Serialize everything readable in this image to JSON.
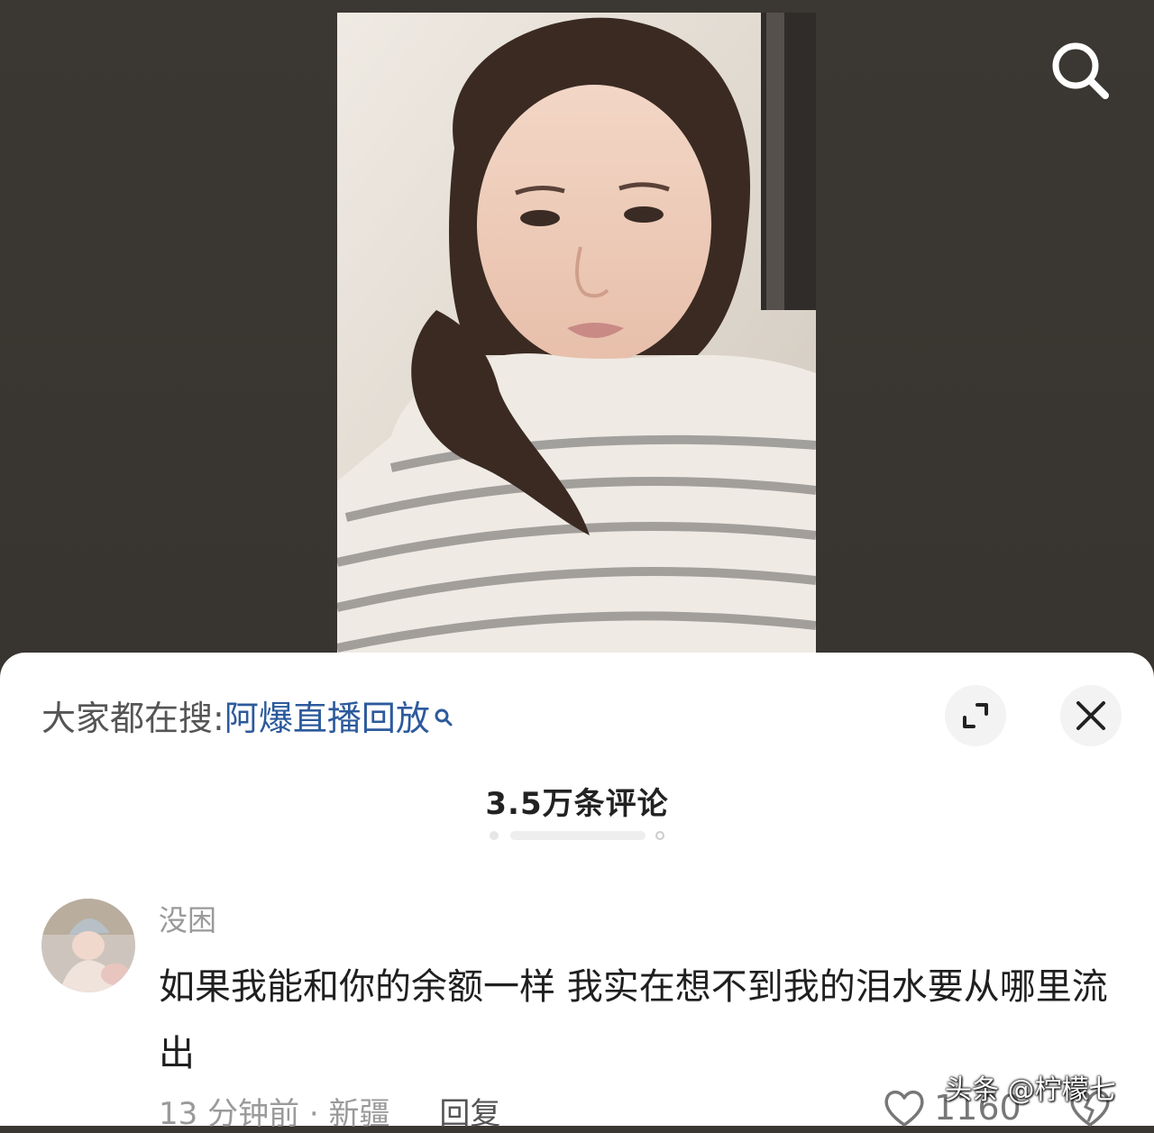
{
  "video": {
    "description_icon": "video-person-frame"
  },
  "toolbar": {
    "search_icon": "search-icon"
  },
  "hot_search": {
    "prefix": "大家都在搜:",
    "link_text": "阿爆直播回放",
    "link_icon": "search-icon"
  },
  "panel_controls": {
    "expand_icon": "expand-icon",
    "close_icon": "close-icon"
  },
  "comments_header": {
    "count_label": "3.5万条评论"
  },
  "comments": [
    {
      "username": "没困",
      "text": "如果我能和你的余额一样 我实在想不到我的泪水要从哪里流出",
      "time": "13 分钟前",
      "location": "新疆",
      "meta_separator": "·",
      "reply_label": "回复",
      "likes": "1160"
    }
  ],
  "watermark": {
    "text": "头条 @柠檬七"
  },
  "colors": {
    "backdrop": "#3a3631",
    "sheet": "#ffffff",
    "link": "#2c5a9c",
    "muted_text": "#9a9a9a"
  }
}
